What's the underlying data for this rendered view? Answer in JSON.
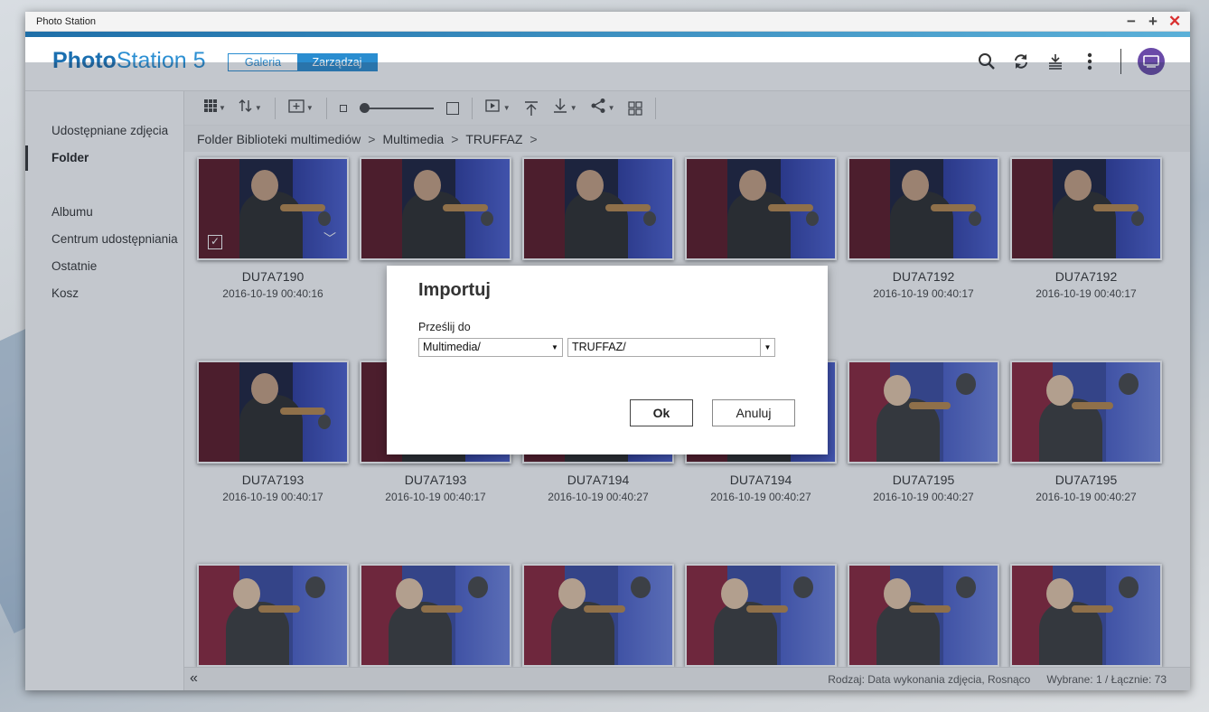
{
  "window": {
    "title": "Photo Station"
  },
  "app": {
    "logo_bold": "Photo",
    "logo_rest": "Station 5",
    "mode_switch": {
      "gallery": "Galeria",
      "manage": "Zarządzaj"
    }
  },
  "sidebar": {
    "items": [
      {
        "label": "Udostępniane zdjęcia",
        "active": false
      },
      {
        "label": "Folder",
        "active": true
      },
      {
        "label": "Albumu",
        "active": false
      },
      {
        "label": "Centrum udostępniania",
        "active": false
      },
      {
        "label": "Ostatnie",
        "active": false
      },
      {
        "label": "Kosz",
        "active": false
      }
    ]
  },
  "breadcrumb": [
    "Folder Biblioteki multimediów",
    "Multimedia",
    "TRUFFAZ"
  ],
  "breadcrumb_separator": ">",
  "photos": [
    {
      "name": "DU7A7190",
      "date": "2016-10-19 00:40:16",
      "scene": "dark",
      "selected_hover": true
    },
    {
      "name": "",
      "date": "",
      "scene": "dark"
    },
    {
      "name": "",
      "date": "",
      "scene": "dark"
    },
    {
      "name": "",
      "date": "",
      "scene": "dark"
    },
    {
      "name": "DU7A7192",
      "date": "2016-10-19 00:40:17",
      "scene": "dark"
    },
    {
      "name": "DU7A7192",
      "date": "2016-10-19 00:40:17",
      "scene": "dark"
    },
    {
      "name": "DU7A7193",
      "date": "2016-10-19 00:40:17",
      "scene": "dark"
    },
    {
      "name": "DU7A7193",
      "date": "2016-10-19 00:40:17",
      "scene": "dark"
    },
    {
      "name": "DU7A7194",
      "date": "2016-10-19 00:40:27",
      "scene": "dark"
    },
    {
      "name": "DU7A7194",
      "date": "2016-10-19 00:40:27",
      "scene": "dark"
    },
    {
      "name": "DU7A7195",
      "date": "2016-10-19 00:40:27",
      "scene": "bright"
    },
    {
      "name": "DU7A7195",
      "date": "2016-10-19 00:40:27",
      "scene": "bright"
    },
    {
      "name": "",
      "date": "",
      "scene": "bright"
    },
    {
      "name": "",
      "date": "",
      "scene": "bright"
    },
    {
      "name": "",
      "date": "",
      "scene": "bright"
    },
    {
      "name": "",
      "date": "",
      "scene": "bright"
    },
    {
      "name": "",
      "date": "",
      "scene": "bright"
    },
    {
      "name": "",
      "date": "",
      "scene": "bright"
    }
  ],
  "statusbar": {
    "collapse": "«",
    "sort": "Rodzaj: Data wykonania zdjęcia, Rosnąco",
    "selection": "Wybrane: 1  /  Łącznie: 73"
  },
  "dialog": {
    "title": "Importuj",
    "label": "Prześlij do",
    "select1_value": "Multimedia/",
    "select2_value": "TRUFFAZ/",
    "ok_label": "Ok",
    "cancel_label": "Anuluj"
  },
  "colors": {
    "accent": "#2a8dd0",
    "close": "#d93030",
    "avatar": "#6a4aa8"
  }
}
